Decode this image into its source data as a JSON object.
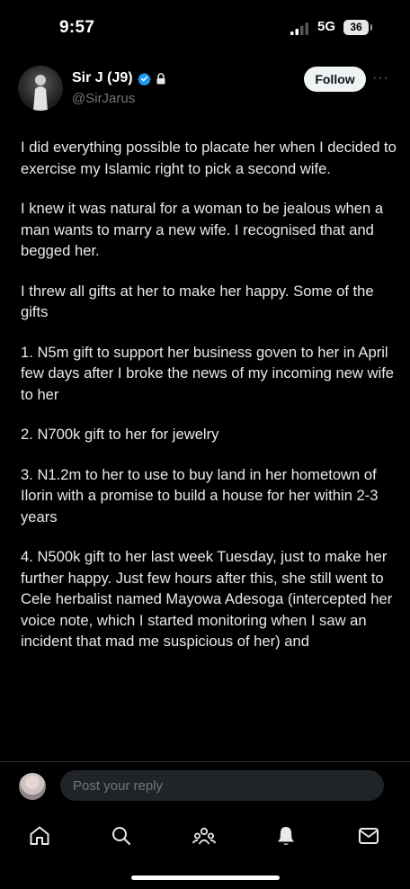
{
  "status_bar": {
    "time": "9:57",
    "network": "5G",
    "battery": "36"
  },
  "author": {
    "name": "Sir J (J9)",
    "handle": "@SirJarus",
    "verified": true,
    "protected": true
  },
  "header": {
    "follow_label": "Follow",
    "more_label": "···"
  },
  "tweet": {
    "paragraphs": [
      "I did everything possible to placate her when I decided to exercise my Islamic right to pick a second wife.",
      "I knew it was natural for a woman to be jealous when a man wants to marry a new wife. I recognised that and begged her.",
      "I threw all gifts at her to make her happy. Some of the gifts",
      "1. N5m gift to support her business goven to her in April few days after I broke the news of my incoming new wife to her",
      "2. N700k gift to her for jewelry",
      "3. N1.2m to her to use to buy land in her hometown of Ilorin with a promise to build a house for her within 2-3 years",
      "4. N500k gift to her last week Tuesday, just to make her further happy. Just few hours after this,  she still went to Cele herbalist named Mayowa Adesoga (intercepted her voice note, which I started monitoring when I saw an incident that mad me suspicious of her) and"
    ]
  },
  "reply": {
    "placeholder": "Post your reply"
  },
  "nav": {
    "items": [
      "home-icon",
      "search-icon",
      "communities-icon",
      "notifications-icon",
      "messages-icon"
    ]
  },
  "colors": {
    "background": "#000000",
    "text": "#e7e9ea",
    "muted": "#71767b",
    "verified": "#1d9bf0",
    "follow_bg": "#eff3f4"
  }
}
